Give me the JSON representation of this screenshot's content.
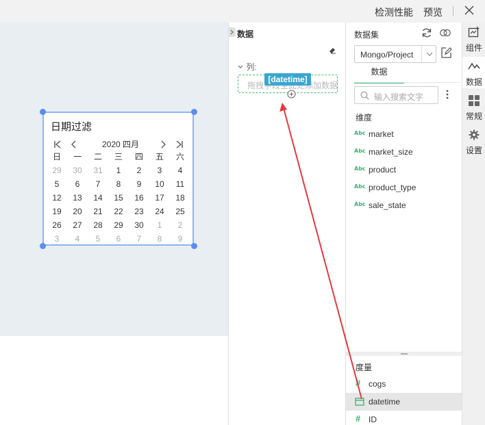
{
  "topbar": {
    "detect_label": "检测性能",
    "preview_label": "预览"
  },
  "widget": {
    "title": "日期过滤",
    "month_label": "2020 四月",
    "weekdays": [
      "日",
      "一",
      "二",
      "三",
      "四",
      "五",
      "六"
    ],
    "weeks": [
      [
        "29",
        "30",
        "31",
        "1",
        "2",
        "3",
        "4"
      ],
      [
        "5",
        "6",
        "7",
        "8",
        "9",
        "10",
        "11"
      ],
      [
        "12",
        "13",
        "14",
        "15",
        "16",
        "17",
        "18"
      ],
      [
        "19",
        "20",
        "21",
        "22",
        "23",
        "24",
        "25"
      ],
      [
        "26",
        "27",
        "28",
        "29",
        "30",
        "1",
        "2"
      ],
      [
        "3",
        "4",
        "5",
        "6",
        "7",
        "8",
        "9"
      ]
    ]
  },
  "middle": {
    "title": "数据",
    "columns_label": "列:",
    "drop_hint": "拖拽字段至此处添加数据",
    "drag_tag": "[datetime]"
  },
  "dataset": {
    "title": "数据集",
    "selected": "Mongo/Project",
    "tab": "数据",
    "search_placeholder": "输入搜索文字",
    "dimension_label": "维度",
    "dimension_icon_text": "Abc",
    "dimensions": [
      "market",
      "market_size",
      "product",
      "product_type",
      "sale_state"
    ],
    "measure_label": "度量",
    "measures": [
      "cogs",
      "datetime",
      "ID"
    ],
    "selected_measure": "datetime"
  },
  "rail": [
    {
      "label": "组件",
      "icon": "component-add-icon"
    },
    {
      "label": "数据",
      "icon": "data-line-icon"
    },
    {
      "label": "常规",
      "icon": "grid-icon"
    },
    {
      "label": "设置",
      "icon": "gear-icon"
    }
  ],
  "colors": {
    "accent": "#3eb370",
    "selection": "#5b8def",
    "drag_tag": "#3aa6d0",
    "arrow": "#e8383d"
  }
}
